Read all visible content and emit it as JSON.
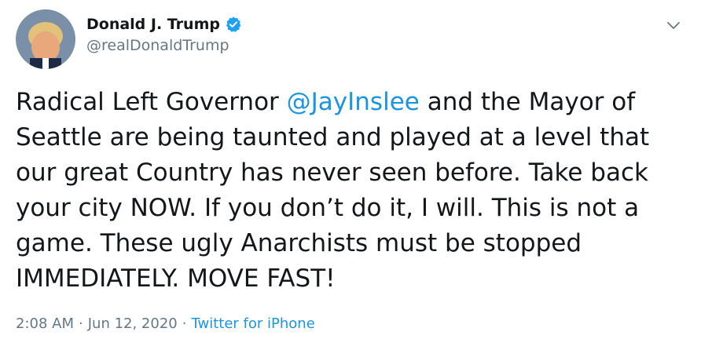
{
  "tweet": {
    "display_name": "Donald J. Trump",
    "handle": "@realDonaldTrump",
    "text_before": "Radical Left Governor ",
    "mention": "@JayInslee",
    "text_after": " and the Mayor of Seattle are being taunted and played at a level that our great Country has never seen before. Take back your city NOW. If you don’t do it, I will. This is not a game. These ugly Anarchists must be stopped IMMEDIATELY. MOVE FAST!",
    "time": "2:08 AM",
    "separator": "·",
    "date": "Jun 12, 2020",
    "source": "Twitter for iPhone"
  },
  "colors": {
    "accent": "#1b95e0",
    "secondary_text": "#657786",
    "primary_text": "#14171a",
    "verified_badge": "#1da1f2"
  },
  "icons": {
    "verified": "verified-badge-icon",
    "menu": "chevron-down-icon"
  }
}
